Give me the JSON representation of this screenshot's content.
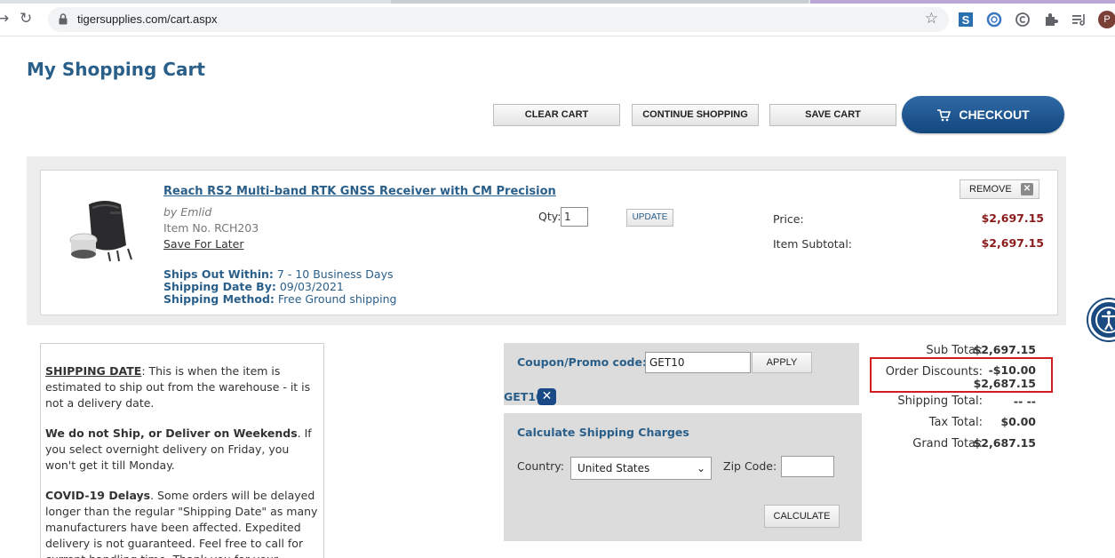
{
  "browser": {
    "url": "tigersupplies.com/cart.aspx",
    "avatar_initial": "P",
    "icons": [
      "back-icon",
      "reload-icon",
      "lock-icon",
      "star-icon",
      "extension-icons",
      "puzzle-icon",
      "reading-list-icon"
    ]
  },
  "page": {
    "title": "My Shopping Cart"
  },
  "actions": {
    "clear_cart": "CLEAR CART",
    "continue_shopping": "CONTINUE SHOPPING",
    "save_cart": "SAVE CART",
    "checkout": "CHECKOUT"
  },
  "item": {
    "name": "Reach RS2 Multi-band RTK GNSS Receiver with CM Precision",
    "brand": "by Emlid",
    "item_no": "Item No. RCH203",
    "save_for_later": "Save For Later",
    "ships_out_label": "Ships Out Within:",
    "ships_out_value": "7 - 10 Business Days",
    "ship_date_label": "Shipping Date By:",
    "ship_date_value": "09/03/2021",
    "ship_method_label": "Shipping Method:",
    "ship_method_value": "Free Ground shipping",
    "qty_label": "Qty:",
    "qty_value": "1",
    "update": "UPDATE",
    "price_label": "Price:",
    "price_value": "$2,697.15",
    "subtotal_label": "Item Subtotal:",
    "subtotal_value": "$2,697.15",
    "remove": "REMOVE"
  },
  "info": {
    "p1_head": "SHIPPING DATE",
    "p1_text": ": This is when the item is estimated to ship out from the warehouse - it is not a delivery date.",
    "p2_head": "We do not Ship, or Deliver on Weekends",
    "p2_text": ". If you select overnight delivery on Friday, you won't get it till Monday.",
    "p3_head": "COVID-19 Delays",
    "p3_text": ". Some orders will be delayed longer than the regular \"Shipping Date\" as many manufacturers have been affected. Expedited delivery is not guaranteed. Feel free to call for current handling time. Thank you for your"
  },
  "coupon": {
    "label": "Coupon/Promo code:",
    "value": "GET10",
    "apply": "APPLY",
    "applied": "GET10"
  },
  "shipping_calc": {
    "title": "Calculate Shipping Charges",
    "country_label": "Country:",
    "country_value": "United States",
    "zip_label": "Zip Code:",
    "zip_value": "",
    "calculate": "CALCULATE"
  },
  "summary": {
    "subtotal_label": "Sub Total:",
    "subtotal_value": "$2,697.15",
    "discount_label": "Order Discounts:",
    "discount_value": "-$10.00",
    "discounted_value": "$2,687.15",
    "shipping_label": "Shipping Total:",
    "shipping_value": "-- --",
    "tax_label": "Tax Total:",
    "tax_value": "$0.00",
    "grand_label": "Grand Total:",
    "grand_value": "$2,687.15"
  },
  "colors": {
    "brand_blue": "#2a5f8a",
    "price_red": "#8b1a1a",
    "highlight_red": "#d01e1e"
  }
}
